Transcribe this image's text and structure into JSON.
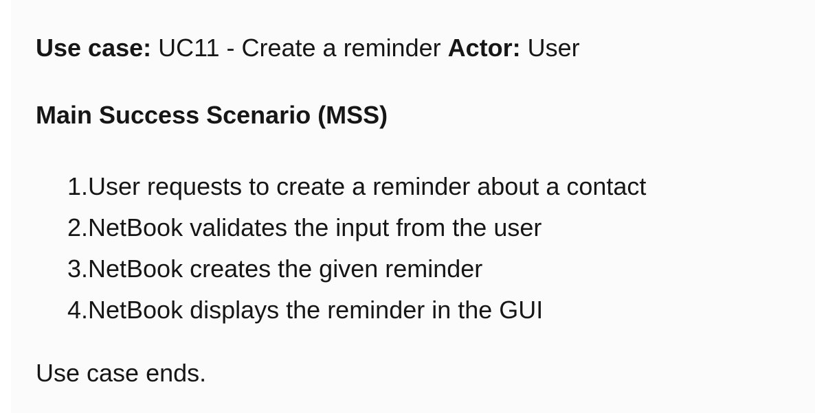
{
  "use_case": {
    "label": "Use case:",
    "value": " UC11 - Create a reminder ",
    "actor_label": "Actor:",
    "actor_value": " User"
  },
  "mss": {
    "heading": "Main Success Scenario (MSS)",
    "steps": [
      {
        "num": "1.",
        "text": " User requests to create a reminder about a contact"
      },
      {
        "num": "2.",
        "text": " NetBook validates the input from the user"
      },
      {
        "num": "3.",
        "text": " NetBook creates the given reminder"
      },
      {
        "num": "4.",
        "text": " NetBook displays the reminder in the GUI"
      }
    ]
  },
  "ending": "Use case ends."
}
